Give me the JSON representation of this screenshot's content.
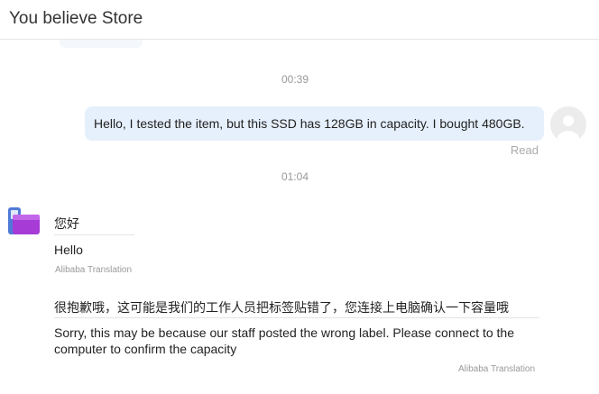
{
  "header": {
    "title": "You believe Store"
  },
  "messages": {
    "time1": "00:39",
    "outgoing": {
      "text": "Hello, I tested the item, but this SSD has 128GB in capacity. I bought 480GB.",
      "status": "Read"
    },
    "time2": "01:04",
    "incoming": [
      {
        "original": "您好",
        "translation": "Hello",
        "translation_source": "Alibaba Translation"
      },
      {
        "original": "很抱歉哦，这可能是我们的工作人员把标签贴错了，您连接上电脑确认一下容量哦",
        "translation": "Sorry, this may be because our staff posted the wrong label. Please connect to the computer to confirm the capacity",
        "translation_source": "Alibaba Translation"
      }
    ]
  },
  "colors": {
    "outgoing_bubble": "#e6f0fc",
    "seller_avatar_primary": "#a63bd6",
    "seller_avatar_secondary": "#4f7ad8"
  },
  "icons": {
    "user_avatar": "person-placeholder-icon",
    "seller_avatar": "store-logo-icon"
  }
}
